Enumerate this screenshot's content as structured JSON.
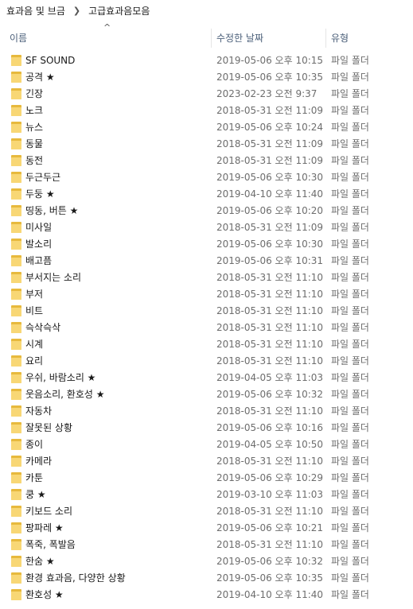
{
  "breadcrumb": {
    "items": [
      "효과음 및 브금",
      "고급효과음모음"
    ]
  },
  "columns": {
    "name": "이름",
    "date": "수정한 날짜",
    "type": "유형"
  },
  "rows": [
    {
      "name": "SF SOUND",
      "date": "2019-05-06 오후 10:15",
      "type": "파일 폴더"
    },
    {
      "name": "공격 ★",
      "date": "2019-05-06 오후 10:35",
      "type": "파일 폴더"
    },
    {
      "name": "긴장",
      "date": "2023-02-23 오전 9:37",
      "type": "파일 폴더"
    },
    {
      "name": "노크",
      "date": "2018-05-31 오전 11:09",
      "type": "파일 폴더"
    },
    {
      "name": "뉴스",
      "date": "2019-05-06 오후 10:24",
      "type": "파일 폴더"
    },
    {
      "name": "동물",
      "date": "2018-05-31 오전 11:09",
      "type": "파일 폴더"
    },
    {
      "name": "동전",
      "date": "2018-05-31 오전 11:09",
      "type": "파일 폴더"
    },
    {
      "name": "두근두근",
      "date": "2019-05-06 오후 10:30",
      "type": "파일 폴더"
    },
    {
      "name": "두둥 ★",
      "date": "2019-04-10 오후 11:40",
      "type": "파일 폴더"
    },
    {
      "name": "띵동, 버튼 ★",
      "date": "2019-05-06 오후 10:20",
      "type": "파일 폴더"
    },
    {
      "name": "미사일",
      "date": "2018-05-31 오전 11:09",
      "type": "파일 폴더"
    },
    {
      "name": "발소리",
      "date": "2019-05-06 오후 10:30",
      "type": "파일 폴더"
    },
    {
      "name": "배고픔",
      "date": "2019-05-06 오후 10:31",
      "type": "파일 폴더"
    },
    {
      "name": "부서지는 소리",
      "date": "2018-05-31 오전 11:10",
      "type": "파일 폴더"
    },
    {
      "name": "부저",
      "date": "2018-05-31 오전 11:10",
      "type": "파일 폴더"
    },
    {
      "name": "비트",
      "date": "2018-05-31 오전 11:10",
      "type": "파일 폴더"
    },
    {
      "name": "슥삭슥삭",
      "date": "2018-05-31 오전 11:10",
      "type": "파일 폴더"
    },
    {
      "name": "시계",
      "date": "2018-05-31 오전 11:10",
      "type": "파일 폴더"
    },
    {
      "name": "요리",
      "date": "2018-05-31 오전 11:10",
      "type": "파일 폴더"
    },
    {
      "name": "우쉬, 바람소리 ★",
      "date": "2019-04-05 오후 11:03",
      "type": "파일 폴더"
    },
    {
      "name": "웃음소리, 환호성 ★",
      "date": "2019-05-06 오후 10:32",
      "type": "파일 폴더"
    },
    {
      "name": "자동차",
      "date": "2018-05-31 오전 11:10",
      "type": "파일 폴더"
    },
    {
      "name": "잘못된 상황",
      "date": "2019-05-06 오후 10:16",
      "type": "파일 폴더"
    },
    {
      "name": "종이",
      "date": "2019-04-05 오후 10:50",
      "type": "파일 폴더"
    },
    {
      "name": "카메라",
      "date": "2018-05-31 오전 11:10",
      "type": "파일 폴더"
    },
    {
      "name": "카툰",
      "date": "2019-05-06 오후 10:29",
      "type": "파일 폴더"
    },
    {
      "name": "쿵 ★",
      "date": "2019-03-10 오후 11:03",
      "type": "파일 폴더"
    },
    {
      "name": "키보드 소리",
      "date": "2018-05-31 오전 11:10",
      "type": "파일 폴더"
    },
    {
      "name": "팡파레 ★",
      "date": "2019-05-06 오후 10:21",
      "type": "파일 폴더"
    },
    {
      "name": "폭죽, 폭발음",
      "date": "2018-05-31 오전 11:10",
      "type": "파일 폴더"
    },
    {
      "name": "한숨 ★",
      "date": "2019-05-06 오후 10:32",
      "type": "파일 폴더"
    },
    {
      "name": "환경 효과음, 다양한 상황",
      "date": "2019-05-06 오후 10:35",
      "type": "파일 폴더"
    },
    {
      "name": "환호성 ★",
      "date": "2019-04-10 오후 11:40",
      "type": "파일 폴더"
    }
  ],
  "colors": {
    "header_text": "#4c607a",
    "folder_front": "#f8d775",
    "folder_back": "#e7b93d",
    "meta_text": "#6d6d6d"
  },
  "icons": {
    "folder": "folder-icon",
    "breadcrumb_separator": "chevron-right-icon",
    "sort": "sort-ascending-icon"
  }
}
